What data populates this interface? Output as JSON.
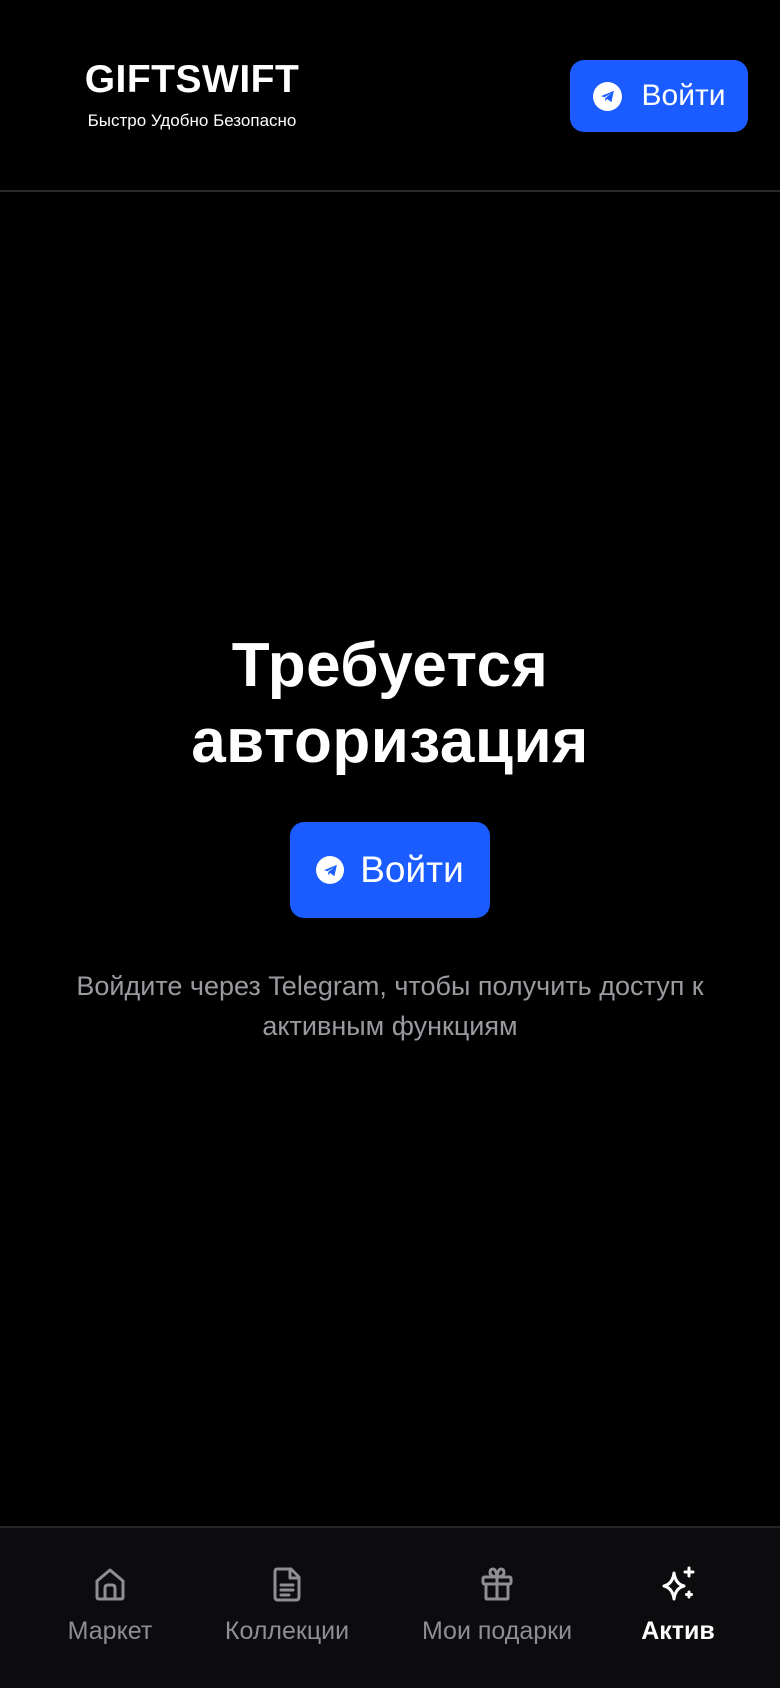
{
  "header": {
    "brand_title": "GIFTSWIFT",
    "brand_tagline": "Быстро Удобно Безопасно",
    "login_label": "Войти"
  },
  "auth": {
    "title_line1": "Требуется",
    "title_line2": "авторизация",
    "login_label": "Войти",
    "description": "Войдите через Telegram, чтобы получить доступ к активным функциям"
  },
  "tabbar": {
    "items": [
      {
        "label": "Маркет",
        "icon": "home-icon",
        "active": false
      },
      {
        "label": "Коллекции",
        "icon": "document-icon",
        "active": false
      },
      {
        "label": "Мои подарки",
        "icon": "gift-icon",
        "active": false
      },
      {
        "label": "Актив",
        "icon": "sparkles-icon",
        "active": true
      }
    ]
  },
  "colors": {
    "background": "#000000",
    "accent": "#1a5cff",
    "muted_text": "#9a9aa0",
    "tab_inactive": "#8e8e93"
  }
}
